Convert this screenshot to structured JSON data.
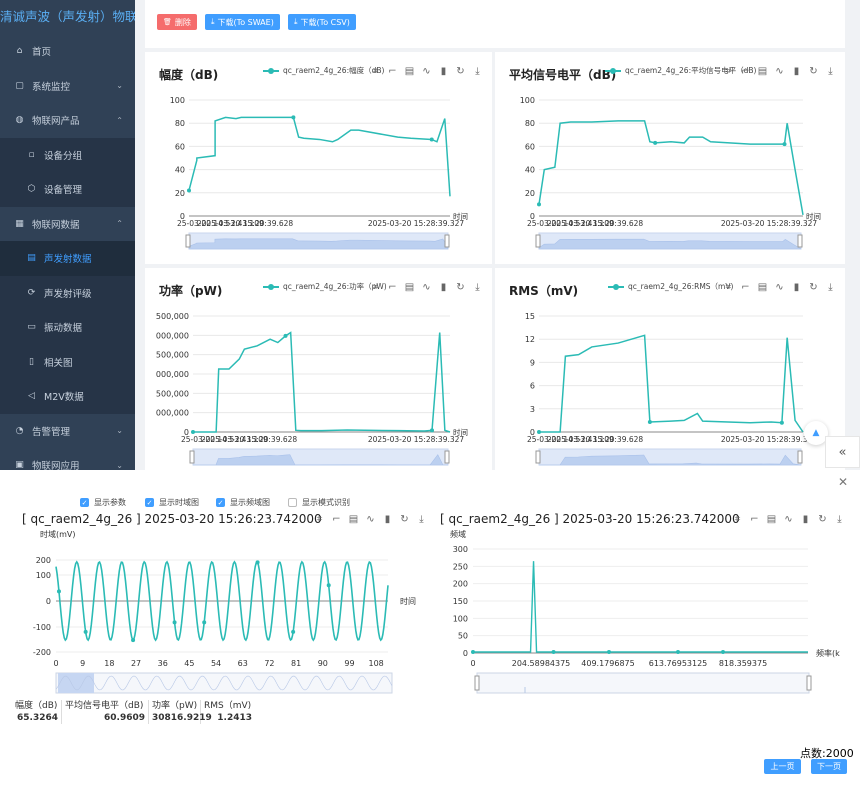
{
  "sidebar": {
    "logo": "清诚声波（声发射）物联网云",
    "items": [
      {
        "label": "首页",
        "icon": "home-icon",
        "level": "top",
        "chev": "",
        "active": false
      },
      {
        "label": "系统监控",
        "icon": "monitor-icon",
        "level": "top",
        "chev": "⌄",
        "active": false
      },
      {
        "label": "物联网产品",
        "icon": "product-icon",
        "level": "top",
        "chev": "⌃",
        "active": false
      },
      {
        "label": "设备分组",
        "icon": "group-icon",
        "level": "sub",
        "chev": "",
        "active": false
      },
      {
        "label": "设备管理",
        "icon": "device-icon",
        "level": "sub",
        "chev": "",
        "active": false
      },
      {
        "label": "物联网数据",
        "icon": "data-icon",
        "level": "top",
        "chev": "⌃",
        "active": false
      },
      {
        "label": "声发射数据",
        "icon": "doc-icon",
        "level": "sub",
        "chev": "",
        "active": true
      },
      {
        "label": "声发射评级",
        "icon": "rating-icon",
        "level": "sub",
        "chev": "",
        "active": false
      },
      {
        "label": "振动数据",
        "icon": "folder-icon",
        "level": "sub",
        "chev": "",
        "active": false
      },
      {
        "label": "相关图",
        "icon": "chart-icon",
        "level": "sub",
        "chev": "",
        "active": false
      },
      {
        "label": "M2V数据",
        "icon": "sound-icon",
        "level": "sub",
        "chev": "",
        "active": false
      },
      {
        "label": "告警管理",
        "icon": "alarm-icon",
        "level": "top",
        "chev": "⌄",
        "active": false
      },
      {
        "label": "物联网应用",
        "icon": "app-icon",
        "level": "top",
        "chev": "⌄",
        "active": false
      }
    ]
  },
  "toolbar": {
    "delete_label": "删除",
    "swae_label": "下载(To SWAE)",
    "csv_label": "下载(To CSV)"
  },
  "colors": {
    "accent": "#409eff",
    "series": "#2bbbb5",
    "sidebar": "#304156",
    "danger": "#f56c6c"
  },
  "cards": [
    {
      "title": "幅度（dB)",
      "legend": "qc_raem2_4g_26:幅度（dB)"
    },
    {
      "title": "平均信号电平（dB)",
      "legend": "qc_raem2_4g_26:平均信号电平（dB)"
    },
    {
      "title": "功率（pW)",
      "legend": "qc_raem2_4g_26:功率（pW)"
    },
    {
      "title": "RMS（mV)",
      "legend": "qc_raem2_4g_26:RMS（mV)"
    }
  ],
  "x_time_label": "时间",
  "x_date_ticks": [
    "25-03-20 14:53:43.109",
    "2025-03-20 15:20:39.628",
    "2025-03-20 15:28:39.327"
  ],
  "checkboxes": [
    {
      "label": "显示参数",
      "checked": true
    },
    {
      "label": "显示时域图",
      "checked": true
    },
    {
      "label": "显示频域图",
      "checked": true
    },
    {
      "label": "显示模式识别",
      "checked": false
    }
  ],
  "detail": {
    "title_left": "[ qc_raem2_4g_26 ] 2025-03-20 15:26:23.742000",
    "title_right": "[ qc_raem2_4g_26 ] 2025-03-20 15:26:23.742000",
    "time_ylabel": "时域(mV)",
    "time_xlabel": "时间",
    "freq_ylabel": "频域",
    "freq_xlabel": "频率(kHz"
  },
  "params": {
    "headers": [
      "幅度（dB)",
      "平均信号电平（dB)",
      "功率（pW)",
      "RMS（mV)"
    ],
    "values": [
      "65.3264",
      "60.9609",
      "30816.9219",
      "1.2413"
    ]
  },
  "points_label": "点数:2000",
  "pager": {
    "prev": "上一页",
    "next": "下一页"
  },
  "chart_data": [
    {
      "type": "line",
      "title": "幅度（dB)",
      "ylim": [
        0,
        100
      ],
      "yticks": [
        "100",
        "80",
        "60",
        "40",
        "20",
        "0"
      ],
      "series": [
        {
          "name": "qc_raem2_4g_26:幅度（dB)",
          "x": [
            0,
            0.03,
            0.03,
            0.1,
            0.1,
            0.14,
            0.18,
            0.2,
            0.25,
            0.38,
            0.4,
            0.42,
            0.44,
            0.5,
            0.55,
            0.57,
            0.62,
            0.65,
            0.8,
            0.85,
            0.93,
            0.95,
            0.98,
            1
          ],
          "values": [
            22,
            48,
            50,
            52,
            82,
            85,
            84,
            85,
            85,
            85,
            85,
            68,
            67,
            66,
            64,
            66,
            74,
            74,
            68,
            67,
            66,
            64,
            84,
            17
          ]
        }
      ]
    },
    {
      "type": "line",
      "title": "平均信号电平（dB)",
      "ylim": [
        0,
        100
      ],
      "yticks": [
        "100",
        "80",
        "60",
        "40",
        "20",
        "0"
      ],
      "series": [
        {
          "name": "qc_raem2_4g_26:平均信号电平（dB)",
          "x": [
            0,
            0.02,
            0.06,
            0.08,
            0.12,
            0.2,
            0.3,
            0.4,
            0.42,
            0.44,
            0.5,
            0.55,
            0.57,
            0.62,
            0.65,
            0.8,
            0.85,
            0.93,
            0.94,
            0.97,
            1
          ],
          "values": [
            10,
            40,
            42,
            80,
            81,
            81,
            82,
            82,
            64,
            63,
            64,
            63,
            68,
            68,
            64,
            62,
            62,
            62,
            80,
            40,
            1
          ]
        }
      ]
    },
    {
      "type": "line",
      "title": "功率（pW)",
      "ylim": [
        0,
        3500000
      ],
      "yticks": [
        "500,000",
        "000,000",
        "500,000",
        "000,000",
        "500,000",
        "000,000",
        "0"
      ],
      "series": [
        {
          "name": "qc_raem2_4g_26:功率（pW)",
          "x": [
            0,
            0.09,
            0.1,
            0.14,
            0.18,
            0.2,
            0.25,
            0.3,
            0.33,
            0.36,
            0.38,
            0.4,
            0.42,
            0.5,
            0.6,
            0.8,
            0.9,
            0.93,
            0.96,
            0.98,
            1
          ],
          "values": [
            0,
            0,
            1900000,
            1900000,
            2200000,
            2500000,
            2600000,
            2800000,
            2700000,
            2900000,
            3000000,
            50000,
            40000,
            40000,
            60000,
            40000,
            30000,
            50000,
            3000000,
            50000,
            0
          ]
        }
      ]
    },
    {
      "type": "line",
      "title": "RMS（mV)",
      "ylim": [
        0,
        15
      ],
      "yticks": [
        "15",
        "12",
        "9",
        "6",
        "3",
        "0"
      ],
      "series": [
        {
          "name": "qc_raem2_4g_26:RMS（mV)",
          "x": [
            0,
            0.08,
            0.1,
            0.15,
            0.2,
            0.3,
            0.35,
            0.4,
            0.42,
            0.5,
            0.55,
            0.6,
            0.62,
            0.8,
            0.88,
            0.92,
            0.94,
            0.97,
            1
          ],
          "values": [
            0,
            0,
            9.8,
            10,
            11,
            11.5,
            12,
            12.5,
            1.3,
            1.4,
            1.5,
            2.4,
            1.4,
            1.2,
            1.3,
            1.2,
            12.2,
            1.5,
            0
          ]
        }
      ]
    },
    {
      "type": "line",
      "title": "时域(mV)",
      "xlabel": "时间",
      "ylabel": "时域(mV)",
      "xlim": [
        0,
        112
      ],
      "ylim": [
        -200,
        200
      ],
      "xticks": [
        "0",
        "9",
        "18",
        "27",
        "36",
        "45",
        "54",
        "63",
        "72",
        "81",
        "90",
        "99",
        "108"
      ],
      "yticks": [
        "200",
        "100",
        "0",
        "-100",
        "-200"
      ],
      "series": [
        {
          "name": "时域",
          "amplitude": 170,
          "period": 7.6,
          "phase": -2.5
        }
      ]
    },
    {
      "type": "line",
      "title": "频域",
      "xlabel": "频率(kHz",
      "ylabel": "频域",
      "ylim": [
        0,
        300
      ],
      "xticks": [
        "0",
        "204.58984375",
        "409.1796875",
        "613.76953125",
        "818.359375"
      ],
      "yticks": [
        "300",
        "250",
        "200",
        "150",
        "100",
        "50",
        "0"
      ],
      "series": [
        {
          "name": "频域",
          "peak_x": 130,
          "peak_y": 265
        }
      ]
    }
  ]
}
